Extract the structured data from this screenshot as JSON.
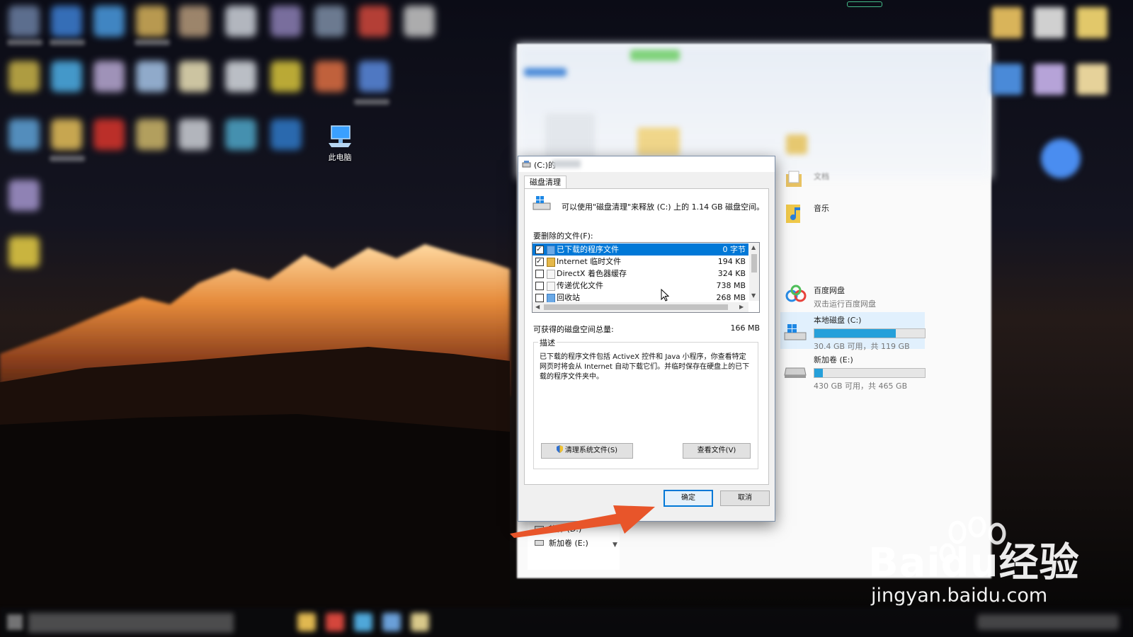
{
  "desktop": {
    "this_pc_label": "此电脑"
  },
  "dialog": {
    "title_prefix": "(C:)的",
    "tab_label": "磁盘清理",
    "intro": "可以使用\"磁盘清理\"来释放 (C:) 上的 1.14 GB 磁盘空间。",
    "files_label": "要删除的文件(F):",
    "files": [
      {
        "name": "已下载的程序文件",
        "size": "0 字节",
        "checked": true,
        "selected": true,
        "icon": "folder-icon"
      },
      {
        "name": "Internet 临时文件",
        "size": "194 KB",
        "checked": true,
        "selected": false,
        "icon": "lock-icon"
      },
      {
        "name": "DirectX 着色器缓存",
        "size": "324 KB",
        "checked": false,
        "selected": false,
        "icon": "file-icon"
      },
      {
        "name": "传递优化文件",
        "size": "738 MB",
        "checked": false,
        "selected": false,
        "icon": "file-icon"
      },
      {
        "name": "回收站",
        "size": "268 MB",
        "checked": false,
        "selected": false,
        "icon": "recycle-bin-icon"
      }
    ],
    "total_label": "可获得的磁盘空间总量:",
    "total_value": "166 MB",
    "description_title": "描述",
    "description": "已下载的程序文件包括 ActiveX 控件和 Java 小程序，你查看特定网页时将会从 Internet 自动下载它们。并临时保存在硬盘上的已下载的程序文件夹中。",
    "clean_system_button": "清理系统文件(S)",
    "view_files_button": "查看文件(V)",
    "ok_button": "确定",
    "cancel_button": "取消"
  },
  "explorer": {
    "music_label": "音乐",
    "docs_label": "文档",
    "baidu_title": "百度网盘",
    "baidu_sub": "双击运行百度网盘",
    "drives": [
      {
        "name": "本地磁盘 (C:)",
        "info": "30.4 GB 可用，共 119 GB",
        "used_fraction": 0.74
      },
      {
        "name": "新加卷 (E:)",
        "info": "430 GB 可用，共 465 GB",
        "used_fraction": 0.08
      }
    ],
    "tree_items": [
      "软件 (D:)",
      "新加卷 (E:)"
    ]
  },
  "watermark": {
    "brand": "Baidu经验",
    "url": "jingyan.baidu.com"
  },
  "colors": {
    "accent": "#0078d7",
    "arrow": "#e8552a",
    "drive_fill": "#26a0da"
  }
}
